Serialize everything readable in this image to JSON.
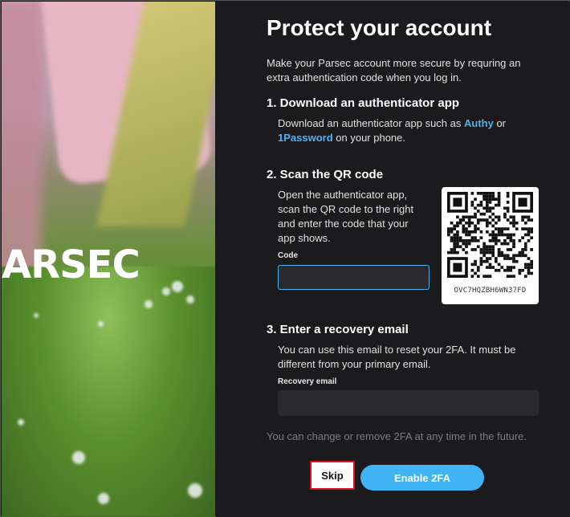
{
  "brand": {
    "wordmark": "ARSEC"
  },
  "header": {
    "title": "Protect your account",
    "intro": "Make your Parsec account more secure by requring an extra authentication code when you log in."
  },
  "step1": {
    "heading": "1. Download an authenticator app",
    "text_before": "Download an authenticator app such as ",
    "link1": "Authy",
    "text_mid": " or",
    "link2": "1Password",
    "text_after": " on your phone."
  },
  "step2": {
    "heading": "2. Scan the QR code",
    "text": "Open the authenticator app, scan the QR code to the right and enter the code that your app shows.",
    "code_label": "Code",
    "code_value": "",
    "qr_secret": "OVC7HQZBH6WN37FD"
  },
  "step3": {
    "heading": "3. Enter a recovery email",
    "text": "You can use this email to reset your 2FA. It must be different from your primary email.",
    "email_label": "Recovery email",
    "email_value": ""
  },
  "footnote": "You can change or remove 2FA at any time in the future.",
  "actions": {
    "skip_label": "Skip",
    "enable_label": "Enable 2FA"
  },
  "colors": {
    "accent": "#3fb3f3",
    "link": "#4db3f0",
    "highlight_border": "#e0101a",
    "background": "#1b1b1d"
  }
}
